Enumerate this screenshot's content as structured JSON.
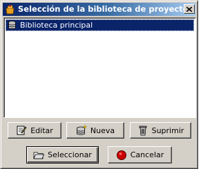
{
  "window": {
    "title": "Selección de la biblioteca de proyectos",
    "icon": "app-icon",
    "close_icon": "close-icon"
  },
  "library_list": {
    "items": [
      {
        "label": "Biblioteca principal",
        "icon": "database-icon",
        "selected": true
      }
    ]
  },
  "buttons": {
    "edit": {
      "label": "Editar",
      "icon": "edit-icon"
    },
    "new": {
      "label": "Nueva",
      "icon": "new-database-icon"
    },
    "delete": {
      "label": "Suprimir",
      "icon": "trash-icon"
    },
    "select": {
      "label": "Seleccionar",
      "icon": "folder-icon"
    },
    "cancel": {
      "label": "Cancelar",
      "icon": "stop-icon"
    }
  },
  "colors": {
    "titlebar_start": "#0a246a",
    "titlebar_end": "#a6caf0",
    "selection": "#0a246a",
    "face": "#d4d0c8",
    "cancel_red": "#cc0000"
  }
}
